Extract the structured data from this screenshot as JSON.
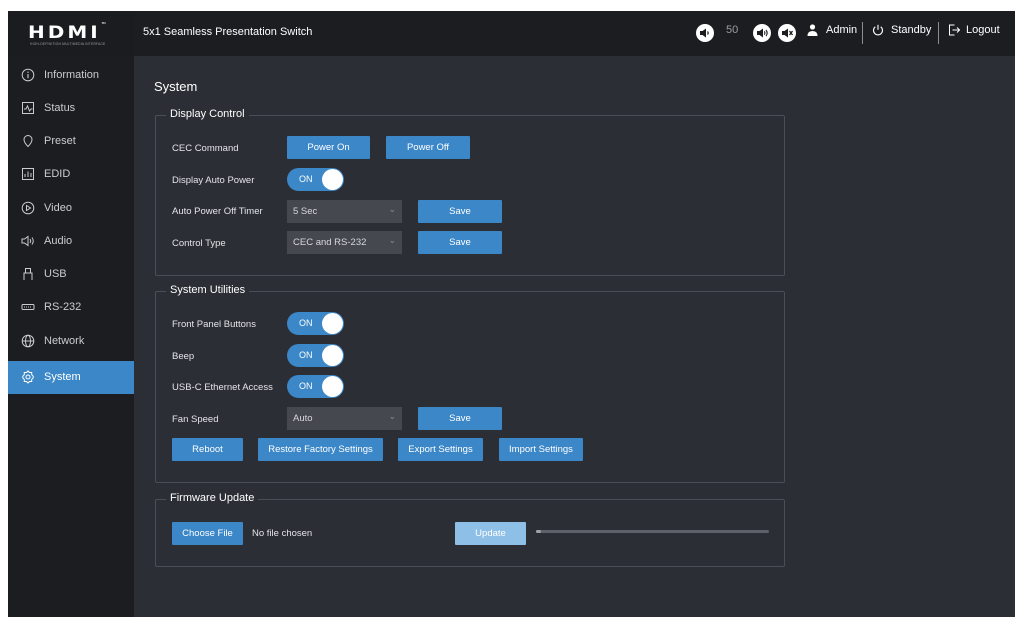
{
  "header": {
    "logo_text": "HDMI",
    "logo_tm": "™",
    "logo_subtext": "HIGH-DEFINITION MULTIMEDIA INTERFACE",
    "title": "5x1 Seamless Presentation Switch",
    "volume_level": "50",
    "user": "Admin",
    "standby": "Standby",
    "logout": "Logout"
  },
  "sidebar": {
    "items": [
      {
        "label": "Information",
        "icon": "info-icon"
      },
      {
        "label": "Status",
        "icon": "status-icon"
      },
      {
        "label": "Preset",
        "icon": "preset-icon"
      },
      {
        "label": "EDID",
        "icon": "edid-icon"
      },
      {
        "label": "Video",
        "icon": "video-icon"
      },
      {
        "label": "Audio",
        "icon": "audio-icon"
      },
      {
        "label": "USB",
        "icon": "usb-icon"
      },
      {
        "label": "RS-232",
        "icon": "rs232-icon"
      },
      {
        "label": "Network",
        "icon": "network-icon"
      },
      {
        "label": "System",
        "icon": "system-gear-icon",
        "active": true
      }
    ]
  },
  "main": {
    "title": "System",
    "display_control": {
      "legend": "Display Control",
      "cec_label": "CEC Command",
      "power_on": "Power On",
      "power_off": "Power Off",
      "auto_power_label": "Display Auto Power",
      "auto_power_value": "ON",
      "timer_label": "Auto Power Off Timer",
      "timer_value": "5 Sec",
      "control_type_label": "Control Type",
      "control_type_value": "CEC and RS-232",
      "save": "Save"
    },
    "system_utilities": {
      "legend": "System Utilities",
      "front_panel_label": "Front Panel Buttons",
      "front_panel_value": "ON",
      "beep_label": "Beep",
      "beep_value": "ON",
      "usbc_label": "USB-C Ethernet Access",
      "usbc_value": "ON",
      "fan_label": "Fan Speed",
      "fan_value": "Auto",
      "save": "Save",
      "reboot": "Reboot",
      "restore": "Restore Factory Settings",
      "export": "Export Settings",
      "import": "Import Settings"
    },
    "firmware": {
      "legend": "Firmware Update",
      "choose_file": "Choose File",
      "file_status": "No file chosen",
      "update": "Update",
      "progress": 0.02
    }
  },
  "colors": {
    "accent": "#3b87c8",
    "background": "#2b2e35",
    "sidebar": "#1c1d21"
  }
}
